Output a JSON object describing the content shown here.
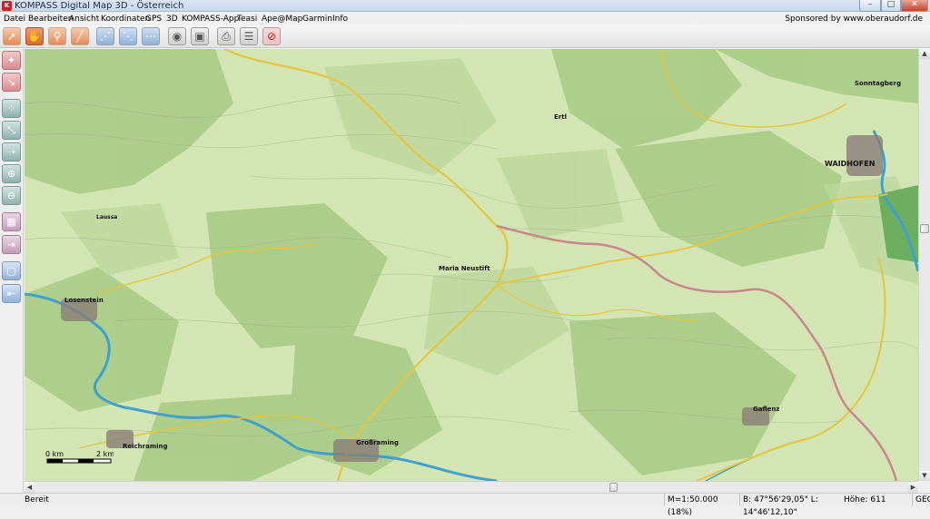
{
  "window": {
    "title": "KOMPASS Digital Map 3D - Österreich",
    "buttons": {
      "minimize": "–",
      "maximize": "□",
      "close": "✕"
    }
  },
  "menu": [
    "Datei",
    "Bearbeiten",
    "Ansicht",
    "Koordinaten",
    "GPS",
    "3D",
    "KOMPASS-App",
    "Teasi",
    "Ape@Map",
    "Garmin",
    "Info"
  ],
  "sponsor": "Sponsored by www.oberaudorf.de",
  "toolbar": {
    "icons": [
      "select-arrow-icon",
      "hand-pan-icon",
      "zoom-magnifier-icon",
      "measure-ruler-icon",
      "route-new-icon",
      "route-edit-icon",
      "route-points-icon",
      "view-eye-icon",
      "3d-cube-icon",
      "print-icon",
      "list-icon",
      "stop-icon"
    ]
  },
  "sidebar": {
    "icons": [
      "route-tool-icon",
      "pin-tool-icon",
      "node-add-icon",
      "node-delete-icon",
      "node-move-icon",
      "waypoint-add-icon",
      "waypoint-remove-icon",
      "select-area-icon",
      "export-icon",
      "select-frame-icon",
      "import-icon"
    ]
  },
  "map": {
    "labels": {
      "waidhofen": "WAIDHOFEN",
      "sonntagberg": "Sonntagberg",
      "maria_neustift": "Maria Neustift",
      "ertl": "Ertl",
      "losenstein": "Losenstein",
      "grossraming": "Großraming",
      "reichraming": "Reichraming",
      "gaflenz": "Gaflenz",
      "laussa": "Laussa"
    },
    "scalebar": {
      "start": "0 km",
      "end": "2 km"
    },
    "colors": {
      "terrain": "#d3e5b3",
      "forest": "#a9cc86",
      "river": "#3fa0cf",
      "road_yellow": "#e6c53c",
      "boundary": "#c9868c"
    }
  },
  "status": {
    "ready": "Bereit",
    "scale": "M=1:50.000 (18%)",
    "coords": "B: 47°56'29,05\"  L: 14°46'12,10\"",
    "height": "Höhe: 611",
    "system": "GEO"
  }
}
